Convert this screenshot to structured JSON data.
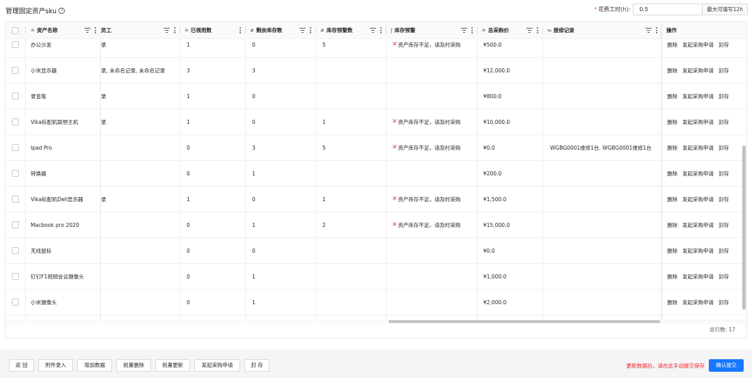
{
  "page": {
    "title": "管理固定资产sku"
  },
  "hours": {
    "label": "花费工时(h):",
    "value": "0.5",
    "addon": "最大可填写12h"
  },
  "columns": {
    "name": "资产名称",
    "employee": "员工",
    "used": "已领用数",
    "remaining": "剩余库存数",
    "threshold": "库存预警数",
    "warning": "库存预警",
    "total_price": "总采购价",
    "repair": "报修记录",
    "actions": "操作"
  },
  "actions": {
    "delete": "删除",
    "purchase": "发起采购申请",
    "seal": "封存"
  },
  "rows": [
    {
      "name": "办公沙发",
      "employee": "录",
      "used": "1",
      "remaining": "0",
      "threshold": "5",
      "warning": "资产库存不足，请及时采购",
      "total_price": "¥500.0",
      "repair": ""
    },
    {
      "name": "小米显示器",
      "employee": "录, 未命名记录, 未命名记录",
      "used": "3",
      "remaining": "3",
      "threshold": "",
      "warning": "",
      "total_price": "¥12,000.0",
      "repair": ""
    },
    {
      "name": "录音笔",
      "employee": "录",
      "used": "1",
      "remaining": "0",
      "threshold": "",
      "warning": "",
      "total_price": "¥800.0",
      "repair": ""
    },
    {
      "name": "Vika标配机联想主机",
      "employee": "录",
      "used": "1",
      "remaining": "0",
      "threshold": "1",
      "warning": "资产库存不足，请及时采购",
      "total_price": "¥10,000.0",
      "repair": ""
    },
    {
      "name": "Ipad Pro",
      "employee": "",
      "used": "0",
      "remaining": "3",
      "threshold": "5",
      "warning": "资产库存不足，请及时采购",
      "total_price": "¥0.0",
      "repair": "WGBG0001维修1台, WGBG0001维修1台"
    },
    {
      "name": "转换器",
      "employee": "",
      "used": "0",
      "remaining": "1",
      "threshold": "",
      "warning": "",
      "total_price": "¥200.0",
      "repair": ""
    },
    {
      "name": "Vika标配机Dell显示器",
      "employee": "录",
      "used": "1",
      "remaining": "0",
      "threshold": "1",
      "warning": "资产库存不足，请及时采购",
      "total_price": "¥1,500.0",
      "repair": ""
    },
    {
      "name": "Macbook pro 2020",
      "employee": "",
      "used": "0",
      "remaining": "1",
      "threshold": "2",
      "warning": "资产库存不足，请及时采购",
      "total_price": "¥15,000.0",
      "repair": ""
    },
    {
      "name": "无线鼠标",
      "employee": "",
      "used": "0",
      "remaining": "0",
      "threshold": "",
      "warning": "",
      "total_price": "¥0.0",
      "repair": ""
    },
    {
      "name": "钉钉F1视频会议摄像头",
      "employee": "",
      "used": "0",
      "remaining": "1",
      "threshold": "",
      "warning": "",
      "total_price": "¥1,000.0",
      "repair": ""
    },
    {
      "name": "小米摄像头",
      "employee": "",
      "used": "0",
      "remaining": "1",
      "threshold": "",
      "warning": "",
      "total_price": "¥2,000.0",
      "repair": ""
    }
  ],
  "summary": {
    "total": "总行数: 17"
  },
  "footer": {
    "back": "返 回",
    "attach": "附件录入",
    "add": "增加数据",
    "batch_delete": "批量删除",
    "batch_update": "批量更新",
    "purchase": "发起采购申请",
    "seal": "封 存",
    "note": "更新数据后，请在此手动提交保存",
    "submit": "确认提交"
  },
  "colors": {
    "primary": "#1677ff",
    "warning": "#e53935",
    "note": "#f5222d"
  }
}
